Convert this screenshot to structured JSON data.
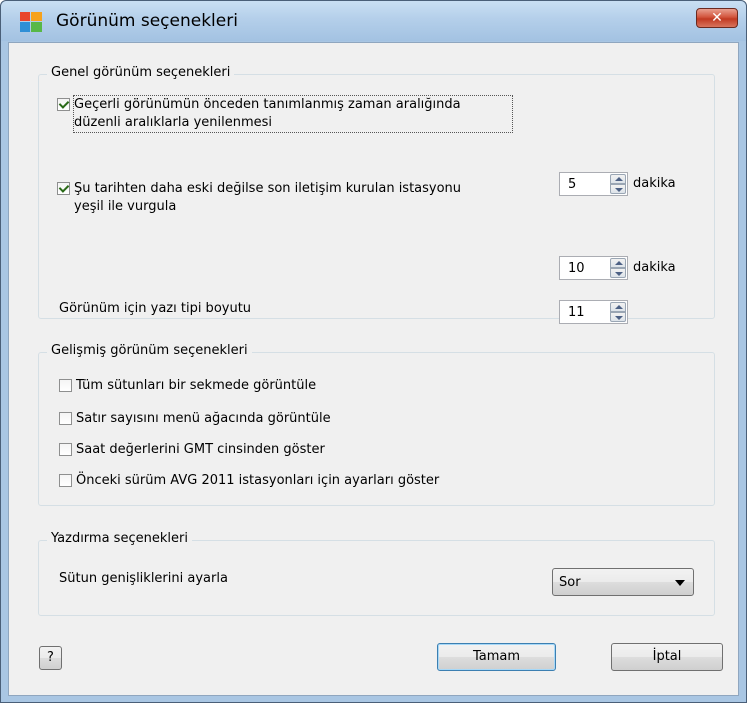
{
  "window": {
    "title": "Görünüm seçenekleri",
    "close_glyph": "✕"
  },
  "general": {
    "title": "Genel görünüm seçenekleri",
    "refresh": {
      "label_line1": "Geçerli görünümün önceden tanımlanmış zaman aralığında",
      "label_line2": "düzenli aralıklarla yenilenmesi",
      "checked": true,
      "value": "5",
      "unit": "dakika"
    },
    "highlight": {
      "label_line1": "Şu tarihten daha eski değilse son iletişim kurulan istasyonu",
      "label_line2": "yeşil ile vurgula",
      "checked": true,
      "value": "10",
      "unit": "dakika"
    },
    "font_size": {
      "label": "Görünüm için yazı tipi boyutu",
      "value": "11"
    }
  },
  "advanced": {
    "title": "Gelişmiş görünüm seçenekleri",
    "items": [
      {
        "label": "Tüm sütunları bir sekmede görüntüle",
        "checked": false
      },
      {
        "label": "Satır sayısını menü ağacında görüntüle",
        "checked": false
      },
      {
        "label": "Saat değerlerini GMT cinsinden göster",
        "checked": false
      },
      {
        "label": "Önceki sürüm AVG 2011 istasyonları için ayarları göster",
        "checked": false
      }
    ]
  },
  "printing": {
    "title": "Yazdırma seçenekleri",
    "column_width": {
      "label": "Sütun genişliklerini ayarla",
      "selected": "Sor"
    }
  },
  "buttons": {
    "help": "?",
    "ok": "Tamam",
    "cancel": "İptal"
  },
  "colors": {
    "window_frame": "#a9c6e3",
    "client_bg": "#f0f0f0",
    "close_red": "#c13a22"
  }
}
